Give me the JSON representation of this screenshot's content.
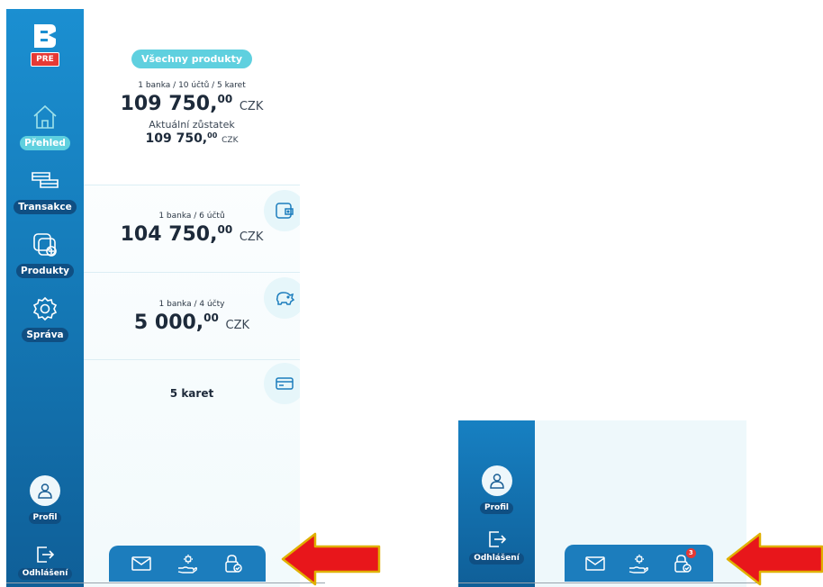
{
  "sidebar": {
    "badge": "PRE",
    "items": [
      {
        "label": "Přehled",
        "icon": "home-icon",
        "active": true
      },
      {
        "label": "Transakce",
        "icon": "transfer-icon"
      },
      {
        "label": "Produkty",
        "icon": "add-card-icon"
      },
      {
        "label": "Správa",
        "icon": "gear-icon"
      }
    ],
    "profile_label": "Profil",
    "logout_label": "Odhlášení"
  },
  "summary": {
    "filter_pill": "Všechny produkty",
    "meta": "1 banka / 10 účtů / 5 karet",
    "total_int": "109 750,",
    "total_dec": "00",
    "currency": "CZK",
    "balance_label": "Aktuální zůstatek",
    "balance_int": "109 750,",
    "balance_dec": "00",
    "balance_currency": "CZK"
  },
  "accounts": [
    {
      "meta": "1 banka / 6 účtů",
      "amount_int": "104 750,",
      "amount_dec": "00",
      "currency": "CZK",
      "icon": "wallet-icon"
    },
    {
      "meta": "1 banka / 4 účty",
      "amount_int": "5 000,",
      "amount_dec": "00",
      "currency": "CZK",
      "icon": "piggy-bank-icon"
    }
  ],
  "cards": {
    "label": "5 karet",
    "icon": "credit-card-icon"
  },
  "bottom_bar": {
    "icons": [
      "mail-icon",
      "hand-gear-icon",
      "lock-check-icon"
    ],
    "notification_count": "3"
  },
  "colors": {
    "sidebar": "#1b8fd1",
    "accent": "#5fd0df",
    "arrow": "#e8161b",
    "arrow_outline": "#e0b000",
    "badge": "#e53935"
  }
}
